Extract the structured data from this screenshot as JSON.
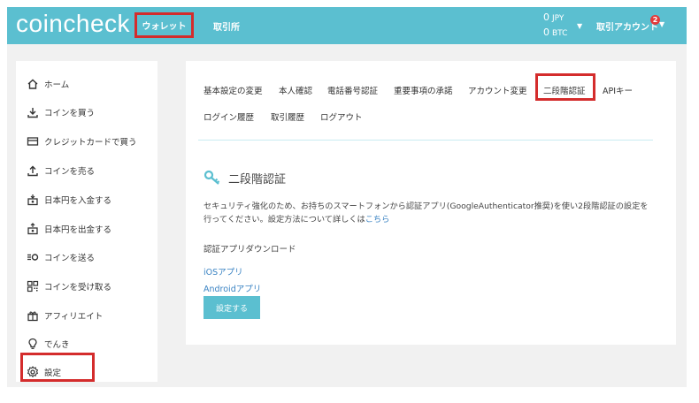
{
  "header": {
    "logo": "coincheck",
    "nav_wallet": "ウォレット",
    "nav_exchange": "取引所",
    "balance": [
      {
        "amount": "0",
        "unit": "JPY"
      },
      {
        "amount": "0",
        "unit": "BTC"
      }
    ],
    "account_label": "取引アカウント",
    "notification_count": "2"
  },
  "sidebar": {
    "items": [
      {
        "label": "ホーム",
        "icon": "home-icon"
      },
      {
        "label": "コインを買う",
        "icon": "download-icon"
      },
      {
        "label": "クレジットカードで買う",
        "icon": "credit-card-icon"
      },
      {
        "label": "コインを売る",
        "icon": "upload-icon"
      },
      {
        "label": "日本円を入金する",
        "icon": "deposit-icon"
      },
      {
        "label": "日本円を出金する",
        "icon": "withdraw-icon"
      },
      {
        "label": "コインを送る",
        "icon": "send-icon"
      },
      {
        "label": "コインを受け取る",
        "icon": "qr-code-icon"
      },
      {
        "label": "アフィリエイト",
        "icon": "gift-icon"
      },
      {
        "label": "でんき",
        "icon": "lightbulb-icon"
      },
      {
        "label": "設定",
        "icon": "gear-icon"
      }
    ]
  },
  "tabs": {
    "row1": [
      "基本設定の変更",
      "本人確認",
      "電話番号認証",
      "重要事項の承諾",
      "アカウント変更",
      "二段階認証",
      "APIキー"
    ],
    "row2": [
      "ログイン履歴",
      "取引履歴",
      "ログアウト"
    ]
  },
  "content": {
    "title": "二段階認証",
    "description": "セキュリティ強化のため、お持ちのスマートフォンから認証アプリ(GoogleAuthenticator推奨)を使い2段階認証の設定を行ってください。設定方法について詳しくは",
    "description_link": "こちら",
    "download_label": "認証アプリダウンロード",
    "ios_link": "iOSアプリ",
    "android_link": "Androidアプリ",
    "setup_button": "設定する"
  },
  "colors": {
    "brand": "#5bbfd0",
    "highlight": "#d42c2c",
    "link": "#3a83c3"
  }
}
